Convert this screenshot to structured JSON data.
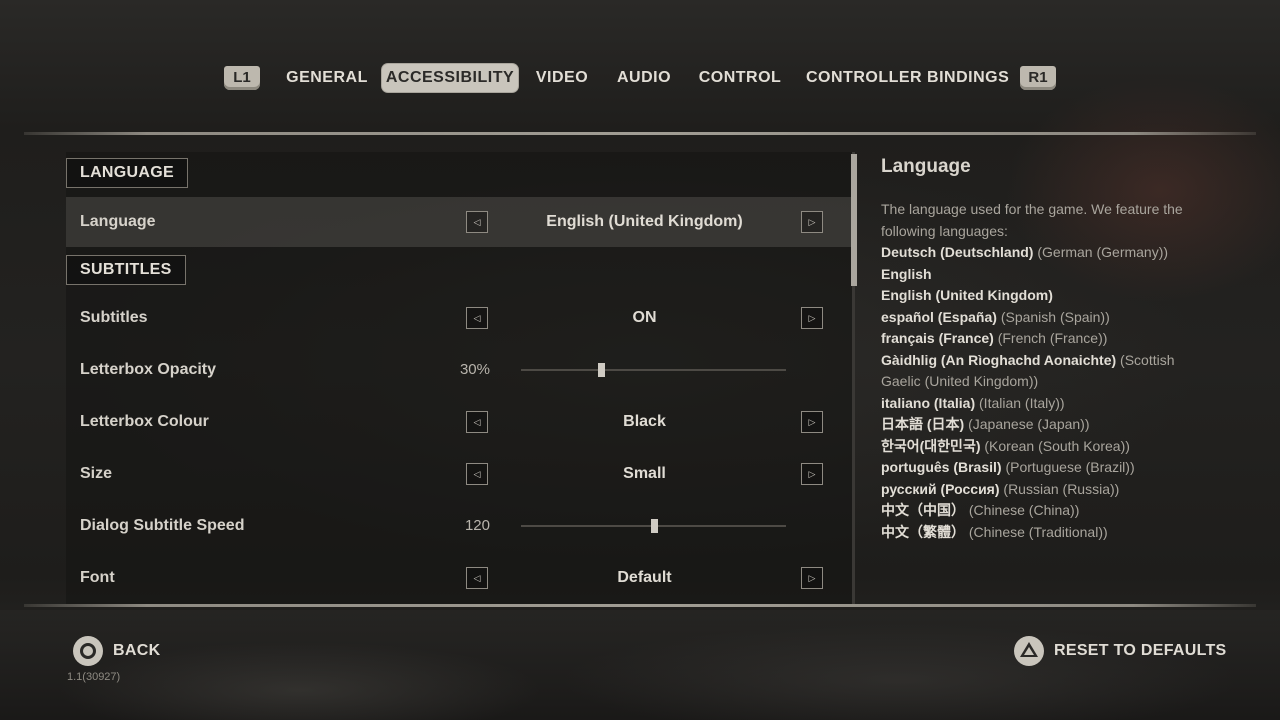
{
  "tabs": {
    "left_bumper": "L1",
    "right_bumper": "R1",
    "items": [
      {
        "label": "GENERAL"
      },
      {
        "label": "ACCESSIBILITY"
      },
      {
        "label": "VIDEO"
      },
      {
        "label": "AUDIO"
      },
      {
        "label": "CONTROL"
      },
      {
        "label": "CONTROLLER BINDINGS"
      }
    ],
    "active": "ACCESSIBILITY"
  },
  "sections": {
    "language": "LANGUAGE",
    "subtitles": "SUBTITLES"
  },
  "settings": {
    "language": {
      "label": "Language",
      "value": "English (United Kingdom)"
    },
    "subtitles": {
      "label": "Subtitles",
      "value": "ON"
    },
    "letterbox_opacity": {
      "label": "Letterbox Opacity",
      "value": "30%",
      "fraction": 0.3
    },
    "letterbox_colour": {
      "label": "Letterbox Colour",
      "value": "Black"
    },
    "size": {
      "label": "Size",
      "value": "Small"
    },
    "dialog_subtitle_speed": {
      "label": "Dialog Subtitle Speed",
      "value": "120",
      "fraction": 0.5
    },
    "font": {
      "label": "Font",
      "value": "Default"
    }
  },
  "info": {
    "title": "Language",
    "description": "The language used for the game. We feature the following languages:",
    "languages": [
      {
        "native": "Deutsch (Deutschland)",
        "english": "(German (Germany))"
      },
      {
        "native": "English",
        "english": ""
      },
      {
        "native": "English (United Kingdom)",
        "english": ""
      },
      {
        "native": "español (España)",
        "english": "(Spanish (Spain))"
      },
      {
        "native": "français (France)",
        "english": "(French (France))"
      },
      {
        "native": "Gàidhlig (An Rìoghachd Aonaichte)",
        "english": "(Scottish Gaelic (United Kingdom))"
      },
      {
        "native": "italiano (Italia)",
        "english": "(Italian (Italy))"
      },
      {
        "native": "日本語 (日本)",
        "english": "(Japanese (Japan))"
      },
      {
        "native": "한국어(대한민국)",
        "english": "(Korean (South Korea))"
      },
      {
        "native": "português (Brasil)",
        "english": "(Portuguese (Brazil))"
      },
      {
        "native": "русский (Россия)",
        "english": "(Russian (Russia))"
      },
      {
        "native": "中文（中国）",
        "english": "(Chinese (China))"
      },
      {
        "native": "中文（繁體）",
        "english": "(Chinese (Traditional))"
      }
    ]
  },
  "footer": {
    "back_label": "BACK",
    "reset_label": "RESET TO DEFAULTS",
    "version": "1.1(30927)",
    "back_icon": "circle-button-icon",
    "reset_icon": "triangle-button-icon"
  }
}
